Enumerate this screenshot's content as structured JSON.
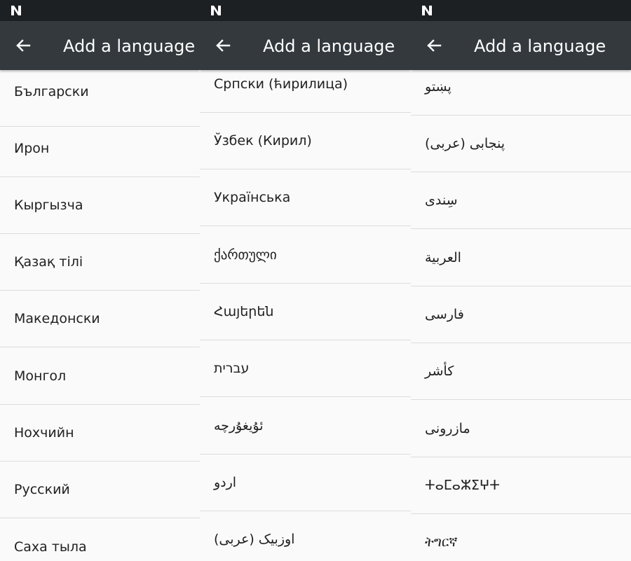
{
  "screens": [
    {
      "title": "Add a language",
      "languages": [
        "Български",
        "Ирон",
        "Кыргызча",
        "Қазақ тілі",
        "Македонски",
        "Монгол",
        "Нохчийн",
        "Русский",
        "Саха тыла"
      ]
    },
    {
      "title": "Add a language",
      "languages": [
        "Српски (ћирилица)",
        "Ўзбек (Кирил)",
        "Українська",
        "ქართული",
        "Հայերեն",
        "עברית",
        "ئۇيغۇرچە",
        "اردو",
        "اوزبیک (عربی)"
      ]
    },
    {
      "title": "Add a language",
      "languages": [
        "پښتو",
        "پنجابی (عربی)",
        "سِندی",
        "العربية",
        "فارسی",
        "كأشر",
        "مازرونی",
        "ⵜⴰⵎⴰⵣⵉⵖⵜ",
        "ትግርኛ"
      ]
    }
  ],
  "icons": {
    "status": "android-n-logo-icon",
    "back": "back-arrow-icon"
  },
  "colors": {
    "status_bar": "#1d2023",
    "app_bar": "#33393d",
    "list_background": "#fafafa",
    "divider": "#dcdcdc",
    "text": "#212121"
  }
}
